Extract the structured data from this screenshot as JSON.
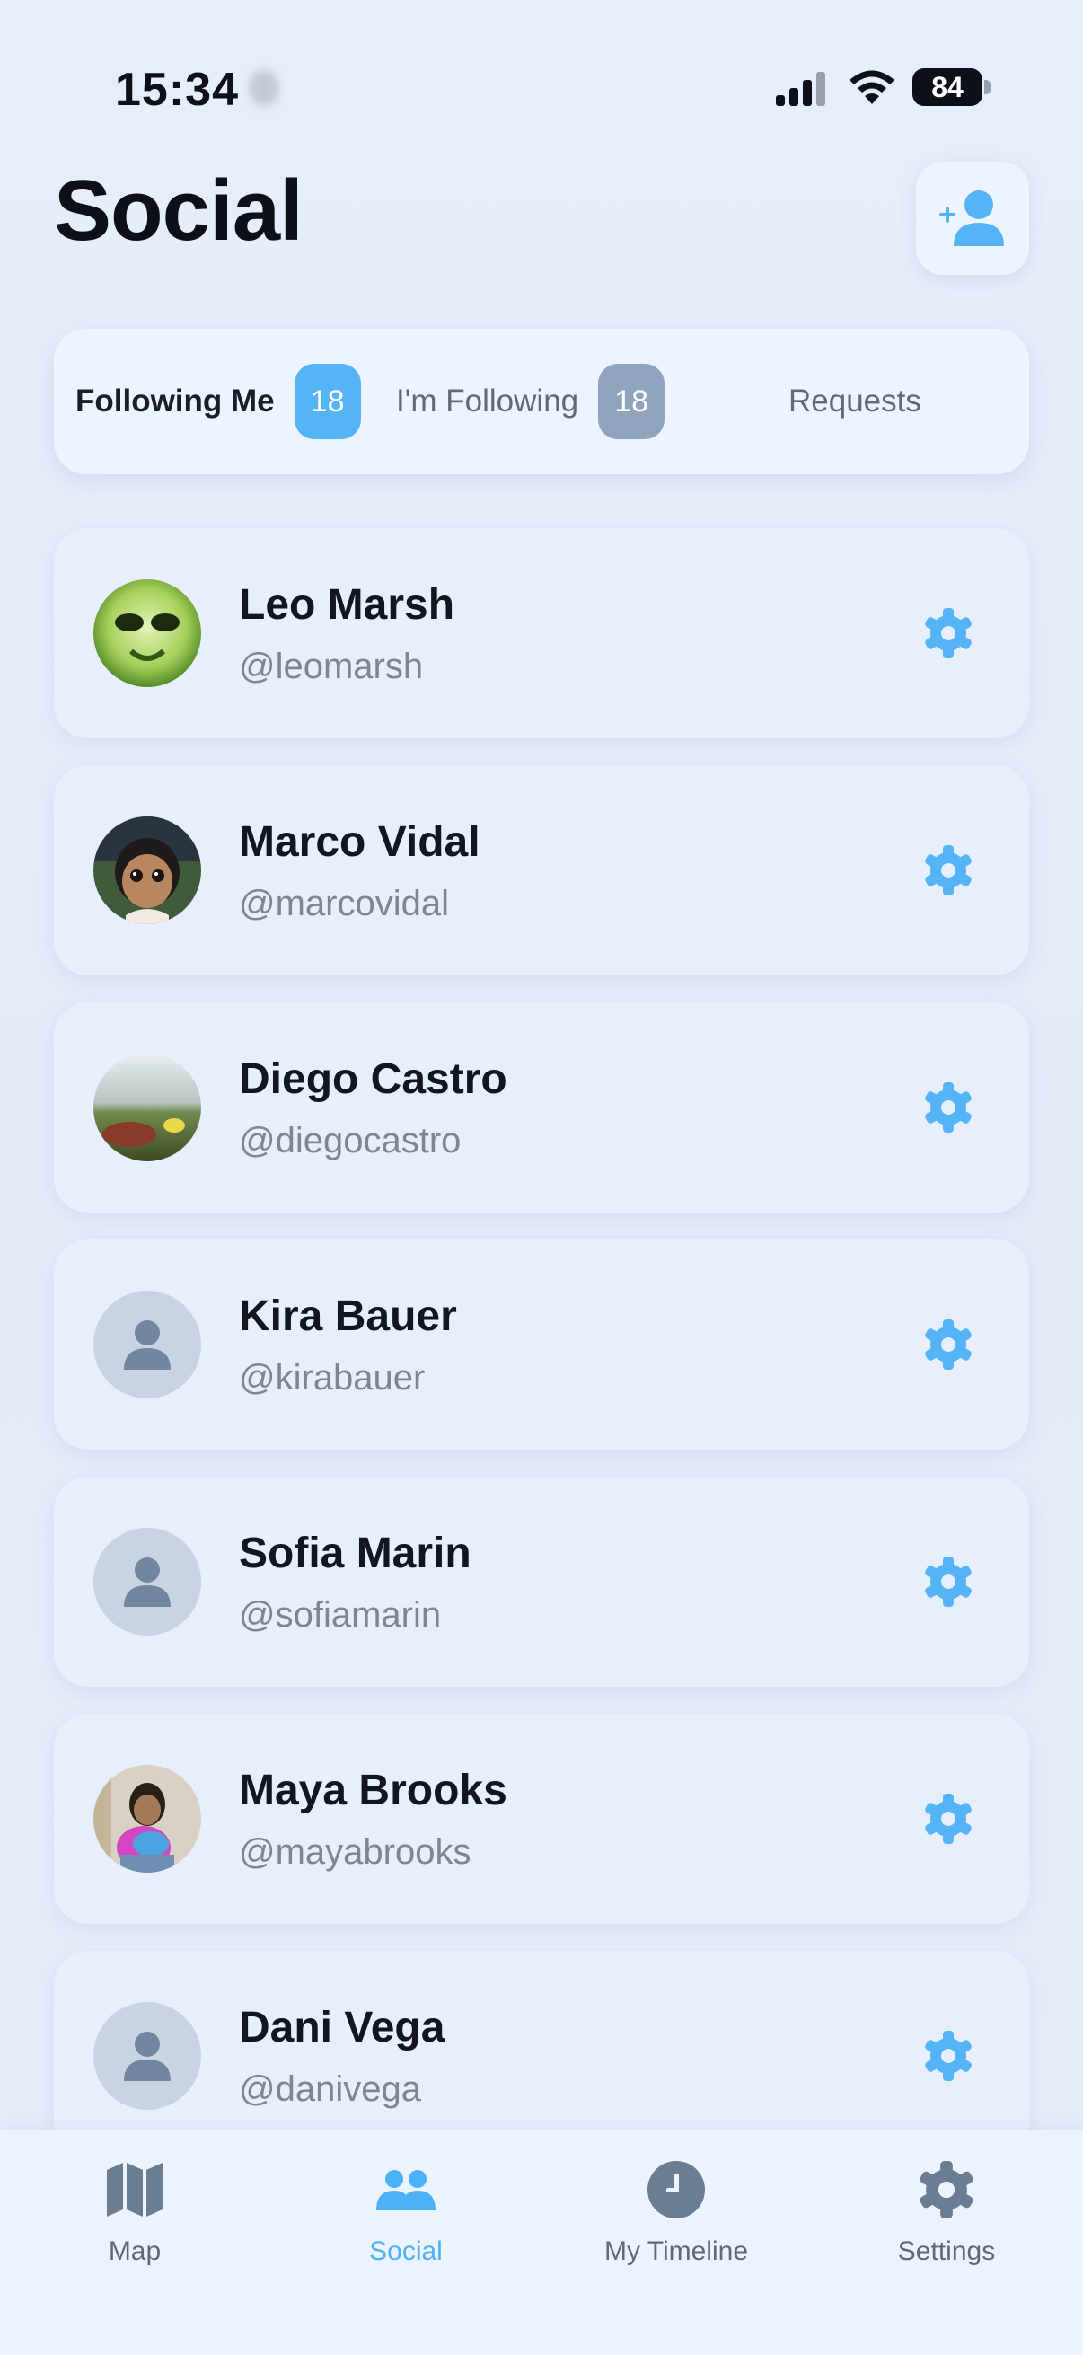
{
  "status_bar": {
    "time": "15:34",
    "battery": "84"
  },
  "header": {
    "title": "Social",
    "add_button_icon": "add-person-icon"
  },
  "tabs": [
    {
      "label": "Following Me",
      "count": "18",
      "active": true
    },
    {
      "label": "I'm Following",
      "count": "18",
      "active": false
    },
    {
      "label": "Requests",
      "active": false
    }
  ],
  "users": [
    {
      "name": "Leo Marsh",
      "handle": "@leomarsh",
      "avatar": "photo"
    },
    {
      "name": "Marco Vidal",
      "handle": "@marcovidal",
      "avatar": "photo"
    },
    {
      "name": "Diego Castro",
      "handle": "@diegocastro",
      "avatar": "photo"
    },
    {
      "name": "Kira Bauer",
      "handle": "@kirabauer",
      "avatar": "placeholder"
    },
    {
      "name": "Sofia Marin",
      "handle": "@sofiamarin",
      "avatar": "placeholder"
    },
    {
      "name": "Maya Brooks",
      "handle": "@mayabrooks",
      "avatar": "photo"
    },
    {
      "name": "Dani Vega",
      "handle": "@danivega",
      "avatar": "placeholder"
    }
  ],
  "nav": [
    {
      "label": "Map",
      "icon": "map-icon",
      "active": false
    },
    {
      "label": "Social",
      "icon": "people-icon",
      "active": true
    },
    {
      "label": "My Timeline",
      "icon": "clock-icon",
      "active": false
    },
    {
      "label": "Settings",
      "icon": "gear-icon",
      "active": false
    }
  ],
  "colors": {
    "accent": "#55b4f6",
    "badge_inactive": "#8fa4bd",
    "text_primary": "#12171f",
    "text_secondary": "#7d8693"
  }
}
